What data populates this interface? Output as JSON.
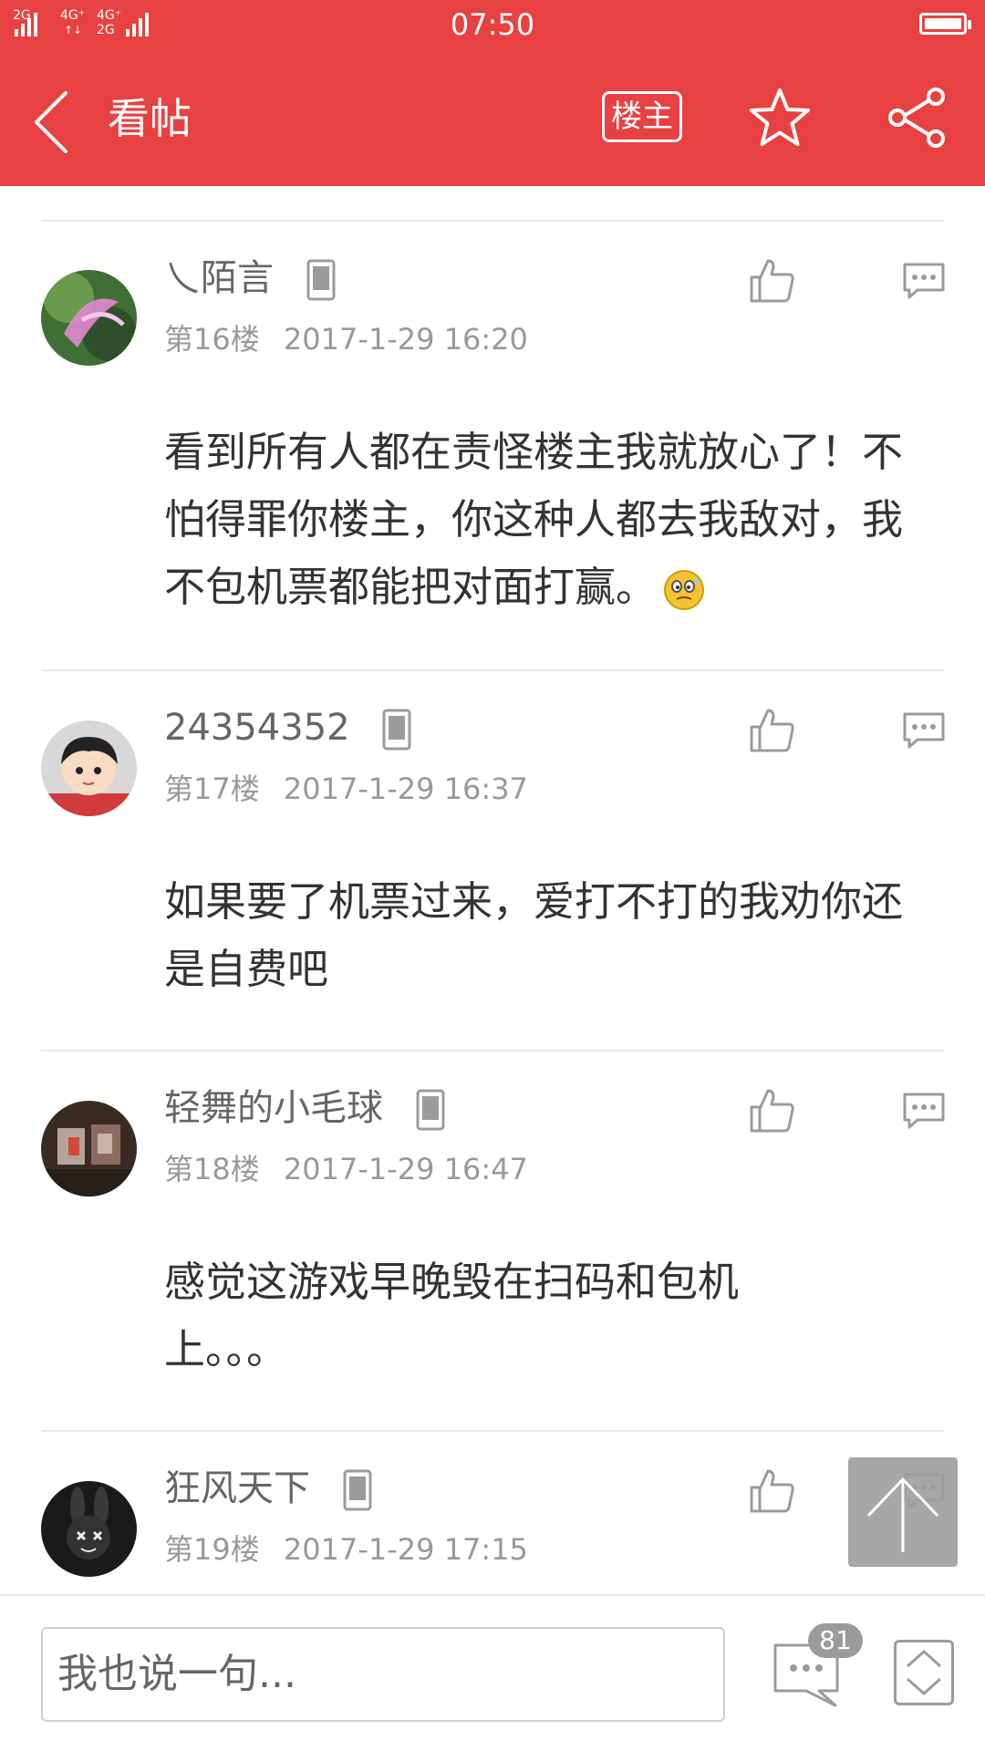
{
  "status_bar": {
    "signal1": "2G",
    "signal2_top": "4G⁺",
    "signal2_bottom": "↑↓",
    "signal3_top": "4G⁺",
    "signal3_bottom": "2G",
    "time": "07:50"
  },
  "header": {
    "title": "看帖",
    "louzhu_label": "楼主",
    "icons": [
      "back-icon",
      "star-icon",
      "share-icon"
    ]
  },
  "posts": [
    {
      "username": "乀陌言",
      "floor": "第16楼",
      "datetime": "2017-1-29 16:20",
      "content": "看到所有人都在责怪楼主我就放心了！不怕得罪你楼主，你这种人都去我敌对，我不包机票都能把对面打赢。"
    },
    {
      "username": "24354352",
      "floor": "第17楼",
      "datetime": "2017-1-29 16:37",
      "content": "如果要了机票过来，爱打不打的我劝你还是自费吧"
    },
    {
      "username": "轻舞的小毛球",
      "floor": "第18楼",
      "datetime": "2017-1-29 16:47",
      "content": "感觉这游戏早晚毁在扫码和包机上。。。"
    },
    {
      "username": "狂风天下",
      "floor": "第19楼",
      "datetime": "2017-1-29 17:15",
      "content": ""
    }
  ],
  "bottom": {
    "input_placeholder": "我也说一句...",
    "comment_count": "81"
  },
  "colors": {
    "brand_red": "#e84141",
    "text_primary": "#333333",
    "text_secondary": "#999999",
    "icon_gray": "#9b9b9b"
  }
}
